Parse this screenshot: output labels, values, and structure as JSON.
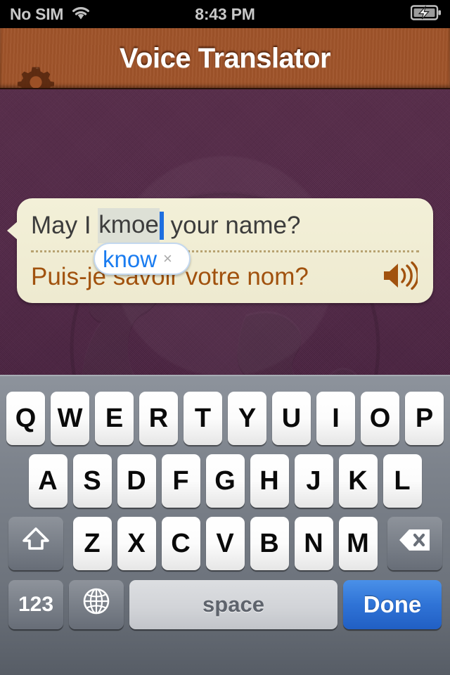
{
  "status_bar": {
    "carrier": "No SIM",
    "wifi_icon": "wifi-icon",
    "time": "8:43 PM",
    "battery_icon": "battery-charging-icon"
  },
  "nav_bar": {
    "title": "Voice Translator",
    "settings_icon": "gear-icon"
  },
  "phrase": {
    "source_prefix": "May I ",
    "source_misspelled": "kmoe",
    "source_suffix": " your name?",
    "source_full": "May I kmoe your name?",
    "translation": "Puis-je savoir votre nom?",
    "speaker_icon": "speaker-icon",
    "autocorrect": {
      "suggestion": "know",
      "dismiss_label": "×"
    }
  },
  "keyboard": {
    "row1": [
      "Q",
      "W",
      "E",
      "R",
      "T",
      "Y",
      "U",
      "I",
      "O",
      "P"
    ],
    "row2": [
      "A",
      "S",
      "D",
      "F",
      "G",
      "H",
      "J",
      "K",
      "L"
    ],
    "row3": [
      "Z",
      "X",
      "C",
      "V",
      "B",
      "N",
      "M"
    ],
    "shift_icon": "shift-icon",
    "backspace_icon": "backspace-icon",
    "numeric_label": "123",
    "globe_icon": "globe-icon",
    "space_label": "space",
    "done_label": "Done"
  },
  "colors": {
    "nav_wood": "#a0542a",
    "background_purple": "#55294a",
    "bubble_cream": "#f0edd4",
    "translation_brown": "#a1520e",
    "suggestion_blue": "#1a7cf0",
    "done_blue": "#2f73d6",
    "caret_blue": "#1f6fe0"
  }
}
